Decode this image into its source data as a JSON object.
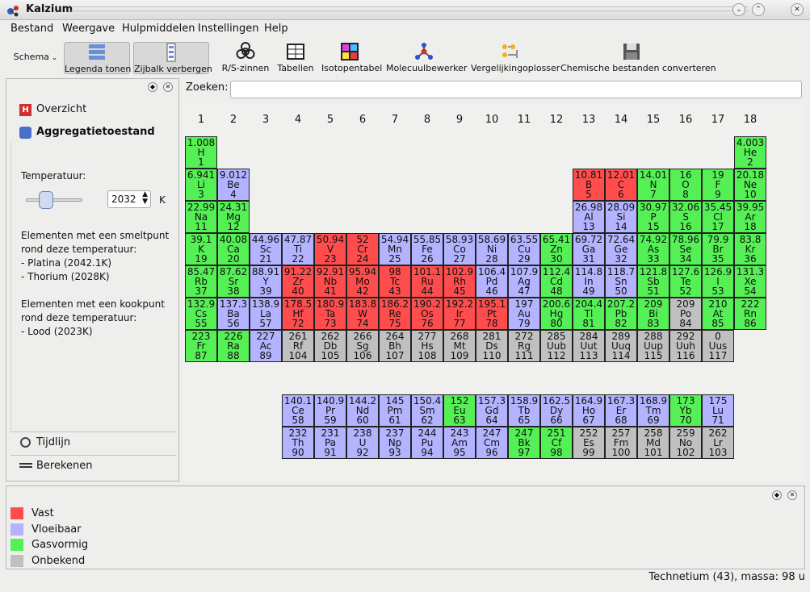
{
  "window": {
    "title": "Kalzium"
  },
  "menu": [
    "Bestand",
    "Weergave",
    "Hulpmiddelen",
    "Instellingen",
    "Help"
  ],
  "toolbar": {
    "schema": "Schema",
    "items": [
      {
        "label": "Legenda tonen",
        "icon": "legend-icon"
      },
      {
        "label": "Zijbalk verbergen",
        "icon": "sidebar-icon"
      },
      {
        "label": "R/S-zinnen",
        "icon": "biohazard-icon"
      },
      {
        "label": "Tabellen",
        "icon": "table-icon"
      },
      {
        "label": "Isotopentabel",
        "icon": "isotope-table-icon"
      },
      {
        "label": "Molecuulbewerker",
        "icon": "molecule-icon"
      },
      {
        "label": "Vergelijkingoplosser",
        "icon": "equation-icon"
      },
      {
        "label": "Chemische bestanden converteren",
        "icon": "floppy-disk-icon"
      }
    ]
  },
  "sidebar": {
    "tabs": [
      "Overzicht",
      "Aggregatietoestand",
      "Tijdlijn",
      "Berekenen"
    ],
    "temperature_label": "Temperatuur:",
    "temperature_value": "2032",
    "temperature_unit": "K",
    "melting_header_1": "Elementen met een smeltpunt",
    "melting_header_2": "rond deze temperatuur:",
    "melting_items": [
      " - Platina (2042.1K)",
      " - Thorium (2028K)"
    ],
    "boiling_header_1": "Elementen met een kookpunt",
    "boiling_header_2": "rond deze temperatuur:",
    "boiling_items": [
      " - Lood (2023K)"
    ]
  },
  "search": {
    "label": "Zoeken:"
  },
  "table": {
    "groups": [
      "1",
      "2",
      "3",
      "4",
      "5",
      "6",
      "7",
      "8",
      "9",
      "10",
      "11",
      "12",
      "13",
      "14",
      "15",
      "16",
      "17",
      "18"
    ],
    "elements": [
      [
        "1.008",
        "H",
        "1",
        1,
        1,
        "gas"
      ],
      [
        "4.003",
        "He",
        "2",
        1,
        18,
        "gas"
      ],
      [
        "6.941",
        "Li",
        "3",
        2,
        1,
        "gas"
      ],
      [
        "9.012",
        "Be",
        "4",
        2,
        2,
        "liquid"
      ],
      [
        "10.81",
        "B",
        "5",
        2,
        13,
        "solid"
      ],
      [
        "12.01",
        "C",
        "6",
        2,
        14,
        "solid"
      ],
      [
        "14.01",
        "N",
        "7",
        2,
        15,
        "gas"
      ],
      [
        "16",
        "O",
        "8",
        2,
        16,
        "gas"
      ],
      [
        "19",
        "F",
        "9",
        2,
        17,
        "gas"
      ],
      [
        "20.18",
        "Ne",
        "10",
        2,
        18,
        "gas"
      ],
      [
        "22.99",
        "Na",
        "11",
        3,
        1,
        "gas"
      ],
      [
        "24.31",
        "Mg",
        "12",
        3,
        2,
        "gas"
      ],
      [
        "26.98",
        "Al",
        "13",
        3,
        13,
        "liquid"
      ],
      [
        "28.09",
        "Si",
        "14",
        3,
        14,
        "liquid"
      ],
      [
        "30.97",
        "P",
        "15",
        3,
        15,
        "gas"
      ],
      [
        "32.06",
        "S",
        "16",
        3,
        16,
        "gas"
      ],
      [
        "35.45",
        "Cl",
        "17",
        3,
        17,
        "gas"
      ],
      [
        "39.95",
        "Ar",
        "18",
        3,
        18,
        "gas"
      ],
      [
        "39.1",
        "K",
        "19",
        4,
        1,
        "gas"
      ],
      [
        "40.08",
        "Ca",
        "20",
        4,
        2,
        "gas"
      ],
      [
        "44.96",
        "Sc",
        "21",
        4,
        3,
        "liquid"
      ],
      [
        "47.87",
        "Ti",
        "22",
        4,
        4,
        "liquid"
      ],
      [
        "50.94",
        "V",
        "23",
        4,
        5,
        "solid"
      ],
      [
        "52",
        "Cr",
        "24",
        4,
        6,
        "solid"
      ],
      [
        "54.94",
        "Mn",
        "25",
        4,
        7,
        "liquid"
      ],
      [
        "55.85",
        "Fe",
        "26",
        4,
        8,
        "liquid"
      ],
      [
        "58.93",
        "Co",
        "27",
        4,
        9,
        "liquid"
      ],
      [
        "58.69",
        "Ni",
        "28",
        4,
        10,
        "liquid"
      ],
      [
        "63.55",
        "Cu",
        "29",
        4,
        11,
        "liquid"
      ],
      [
        "65.41",
        "Zn",
        "30",
        4,
        12,
        "gas"
      ],
      [
        "69.72",
        "Ga",
        "31",
        4,
        13,
        "liquid"
      ],
      [
        "72.64",
        "Ge",
        "32",
        4,
        14,
        "liquid"
      ],
      [
        "74.92",
        "As",
        "33",
        4,
        15,
        "gas"
      ],
      [
        "78.96",
        "Se",
        "34",
        4,
        16,
        "gas"
      ],
      [
        "79.9",
        "Br",
        "35",
        4,
        17,
        "gas"
      ],
      [
        "83.8",
        "Kr",
        "36",
        4,
        18,
        "gas"
      ],
      [
        "85.47",
        "Rb",
        "37",
        5,
        1,
        "gas"
      ],
      [
        "87.62",
        "Sr",
        "38",
        5,
        2,
        "gas"
      ],
      [
        "88.91",
        "Y",
        "39",
        5,
        3,
        "liquid"
      ],
      [
        "91.22",
        "Zr",
        "40",
        5,
        4,
        "solid"
      ],
      [
        "92.91",
        "Nb",
        "41",
        5,
        5,
        "solid"
      ],
      [
        "95.94",
        "Mo",
        "42",
        5,
        6,
        "solid"
      ],
      [
        "98",
        "Tc",
        "43",
        5,
        7,
        "solid"
      ],
      [
        "101.1",
        "Ru",
        "44",
        5,
        8,
        "solid"
      ],
      [
        "102.9",
        "Rh",
        "45",
        5,
        9,
        "solid"
      ],
      [
        "106.4",
        "Pd",
        "46",
        5,
        10,
        "liquid"
      ],
      [
        "107.9",
        "Ag",
        "47",
        5,
        11,
        "liquid"
      ],
      [
        "112.4",
        "Cd",
        "48",
        5,
        12,
        "gas"
      ],
      [
        "114.8",
        "In",
        "49",
        5,
        13,
        "liquid"
      ],
      [
        "118.7",
        "Sn",
        "50",
        5,
        14,
        "liquid"
      ],
      [
        "121.8",
        "Sb",
        "51",
        5,
        15,
        "gas"
      ],
      [
        "127.6",
        "Te",
        "52",
        5,
        16,
        "gas"
      ],
      [
        "126.9",
        "I",
        "53",
        5,
        17,
        "gas"
      ],
      [
        "131.3",
        "Xe",
        "54",
        5,
        18,
        "gas"
      ],
      [
        "132.9",
        "Cs",
        "55",
        6,
        1,
        "gas"
      ],
      [
        "137.3",
        "Ba",
        "56",
        6,
        2,
        "liquid"
      ],
      [
        "138.9",
        "La",
        "57",
        6,
        3,
        "liquid"
      ],
      [
        "178.5",
        "Hf",
        "72",
        6,
        4,
        "solid"
      ],
      [
        "180.9",
        "Ta",
        "73",
        6,
        5,
        "solid"
      ],
      [
        "183.8",
        "W",
        "74",
        6,
        6,
        "solid"
      ],
      [
        "186.2",
        "Re",
        "75",
        6,
        7,
        "solid"
      ],
      [
        "190.2",
        "Os",
        "76",
        6,
        8,
        "solid"
      ],
      [
        "192.2",
        "Ir",
        "77",
        6,
        9,
        "solid"
      ],
      [
        "195.1",
        "Pt",
        "78",
        6,
        10,
        "solid"
      ],
      [
        "197",
        "Au",
        "79",
        6,
        11,
        "liquid"
      ],
      [
        "200.6",
        "Hg",
        "80",
        6,
        12,
        "gas"
      ],
      [
        "204.4",
        "Tl",
        "81",
        6,
        13,
        "gas"
      ],
      [
        "207.2",
        "Pb",
        "82",
        6,
        14,
        "gas"
      ],
      [
        "209",
        "Bi",
        "83",
        6,
        15,
        "gas"
      ],
      [
        "209",
        "Po",
        "84",
        6,
        16,
        "unknown"
      ],
      [
        "210",
        "At",
        "85",
        6,
        17,
        "gas"
      ],
      [
        "222",
        "Rn",
        "86",
        6,
        18,
        "gas"
      ],
      [
        "223",
        "Fr",
        "87",
        7,
        1,
        "gas"
      ],
      [
        "226",
        "Ra",
        "88",
        7,
        2,
        "gas"
      ],
      [
        "227",
        "Ac",
        "89",
        7,
        3,
        "liquid"
      ],
      [
        "261",
        "Rf",
        "104",
        7,
        4,
        "unknown"
      ],
      [
        "262",
        "Db",
        "105",
        7,
        5,
        "unknown"
      ],
      [
        "266",
        "Sg",
        "106",
        7,
        6,
        "unknown"
      ],
      [
        "264",
        "Bh",
        "107",
        7,
        7,
        "unknown"
      ],
      [
        "277",
        "Hs",
        "108",
        7,
        8,
        "unknown"
      ],
      [
        "268",
        "Mt",
        "109",
        7,
        9,
        "unknown"
      ],
      [
        "281",
        "Ds",
        "110",
        7,
        10,
        "unknown"
      ],
      [
        "272",
        "Rg",
        "111",
        7,
        11,
        "unknown"
      ],
      [
        "285",
        "Uub",
        "112",
        7,
        12,
        "unknown"
      ],
      [
        "284",
        "Uut",
        "113",
        7,
        13,
        "unknown"
      ],
      [
        "289",
        "Uuq",
        "114",
        7,
        14,
        "unknown"
      ],
      [
        "288",
        "Uup",
        "115",
        7,
        15,
        "unknown"
      ],
      [
        "292",
        "Uuh",
        "116",
        7,
        16,
        "unknown"
      ],
      [
        "0",
        "Uus",
        "117",
        7,
        17,
        "unknown"
      ],
      [
        "140.1",
        "Ce",
        "58",
        9,
        4,
        "liquid"
      ],
      [
        "140.9",
        "Pr",
        "59",
        9,
        5,
        "liquid"
      ],
      [
        "144.2",
        "Nd",
        "60",
        9,
        6,
        "liquid"
      ],
      [
        "145",
        "Pm",
        "61",
        9,
        7,
        "liquid"
      ],
      [
        "150.4",
        "Sm",
        "62",
        9,
        8,
        "liquid"
      ],
      [
        "152",
        "Eu",
        "63",
        9,
        9,
        "gas"
      ],
      [
        "157.3",
        "Gd",
        "64",
        9,
        10,
        "liquid"
      ],
      [
        "158.9",
        "Tb",
        "65",
        9,
        11,
        "liquid"
      ],
      [
        "162.5",
        "Dy",
        "66",
        9,
        12,
        "liquid"
      ],
      [
        "164.9",
        "Ho",
        "67",
        9,
        13,
        "liquid"
      ],
      [
        "167.3",
        "Er",
        "68",
        9,
        14,
        "liquid"
      ],
      [
        "168.9",
        "Tm",
        "69",
        9,
        15,
        "liquid"
      ],
      [
        "173",
        "Yb",
        "70",
        9,
        16,
        "gas"
      ],
      [
        "175",
        "Lu",
        "71",
        9,
        17,
        "liquid"
      ],
      [
        "232",
        "Th",
        "90",
        10,
        4,
        "liquid"
      ],
      [
        "231",
        "Pa",
        "91",
        10,
        5,
        "liquid"
      ],
      [
        "238",
        "U",
        "92",
        10,
        6,
        "liquid"
      ],
      [
        "237",
        "Np",
        "93",
        10,
        7,
        "liquid"
      ],
      [
        "244",
        "Pu",
        "94",
        10,
        8,
        "liquid"
      ],
      [
        "243",
        "Am",
        "95",
        10,
        9,
        "liquid"
      ],
      [
        "247",
        "Cm",
        "96",
        10,
        10,
        "liquid"
      ],
      [
        "247",
        "Bk",
        "97",
        10,
        11,
        "gas"
      ],
      [
        "251",
        "Cf",
        "98",
        10,
        12,
        "gas"
      ],
      [
        "252",
        "Es",
        "99",
        10,
        13,
        "unknown"
      ],
      [
        "257",
        "Fm",
        "100",
        10,
        14,
        "unknown"
      ],
      [
        "258",
        "Md",
        "101",
        10,
        15,
        "unknown"
      ],
      [
        "259",
        "No",
        "102",
        10,
        16,
        "unknown"
      ],
      [
        "262",
        "Lr",
        "103",
        10,
        17,
        "unknown"
      ]
    ]
  },
  "colors": {
    "solid": "#ff4d4d",
    "liquid": "#b3b3ff",
    "gas": "#55f055",
    "unknown": "#c0c0c0"
  },
  "legend": [
    {
      "label": "Vast",
      "state": "solid"
    },
    {
      "label": "Vloeibaar",
      "state": "liquid"
    },
    {
      "label": "Gasvormig",
      "state": "gas"
    },
    {
      "label": "Onbekend",
      "state": "unknown"
    }
  ],
  "status": "Technetium (43), massa: 98 u"
}
